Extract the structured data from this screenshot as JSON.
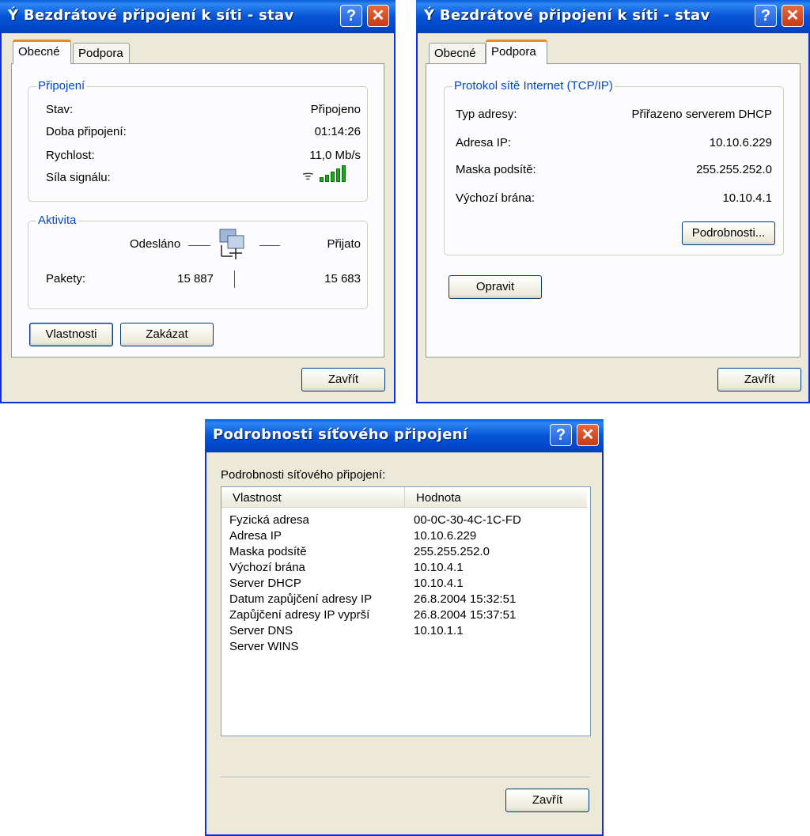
{
  "win1": {
    "title": "Bezdrátové připojení k síti - stav",
    "help_label": "?",
    "close_label": "✕",
    "tabs": [
      {
        "label": "Obecné"
      },
      {
        "label": "Podpora"
      }
    ],
    "connection_group": "Připojení",
    "rows": [
      {
        "label": "Stav:",
        "value": "Připojeno"
      },
      {
        "label": "Doba připojení:",
        "value": "01:14:26"
      },
      {
        "label": "Rychlost:",
        "value": "11,0 Mb/s"
      },
      {
        "label": "Síla signálu:"
      }
    ],
    "signal_bars": 5,
    "activity_group": "Aktivita",
    "sent_label": "Odesláno",
    "received_label": "Přijato",
    "packets_label": "Pakety:",
    "packets_sent": "15 887",
    "packets_received": "15 683",
    "properties_button": "Vlastnosti",
    "disable_button": "Zakázat",
    "close_button": "Zavřít"
  },
  "win2": {
    "title": "Bezdrátové připojení k síti - stav",
    "help_label": "?",
    "close_label": "✕",
    "tabs": [
      {
        "label": "Obecné"
      },
      {
        "label": "Podpora"
      }
    ],
    "tcp_group": "Protokol sítě Internet (TCP/IP)",
    "rows": [
      {
        "label": "Typ adresy:",
        "value": "Přiřazeno serverem DHCP"
      },
      {
        "label": "Adresa IP:",
        "value": "10.10.6.229"
      },
      {
        "label": "Maska podsítě:",
        "value": "255.255.252.0"
      },
      {
        "label": "Výchozí brána:",
        "value": "10.10.4.1"
      }
    ],
    "details_button": "Podrobnosti...",
    "repair_button": "Opravit",
    "close_button": "Zavřít"
  },
  "win3": {
    "title": "Podrobnosti síťového připojení",
    "help_label": "?",
    "close_label": "✕",
    "caption": "Podrobnosti síťového připojení:",
    "columns": [
      "Vlastnost",
      "Hodnota"
    ],
    "rows": [
      {
        "property": "Fyzická adresa",
        "value": "00-0C-30-4C-1C-FD"
      },
      {
        "property": "Adresa IP",
        "value": "10.10.6.229"
      },
      {
        "property": "Maska podsítě",
        "value": "255.255.252.0"
      },
      {
        "property": "Výchozí brána",
        "value": "10.10.4.1"
      },
      {
        "property": "Server DHCP",
        "value": "10.10.4.1"
      },
      {
        "property": "Datum zapůjčení adresy IP",
        "value": "26.8.2004 15:32:51"
      },
      {
        "property": "Zapůjčení adresy IP vyprší",
        "value": "26.8.2004 15:37:51"
      },
      {
        "property": "Server DNS",
        "value": "10.10.1.1"
      },
      {
        "property": "Server WINS",
        "value": ""
      }
    ],
    "close_button": "Zavřít"
  }
}
